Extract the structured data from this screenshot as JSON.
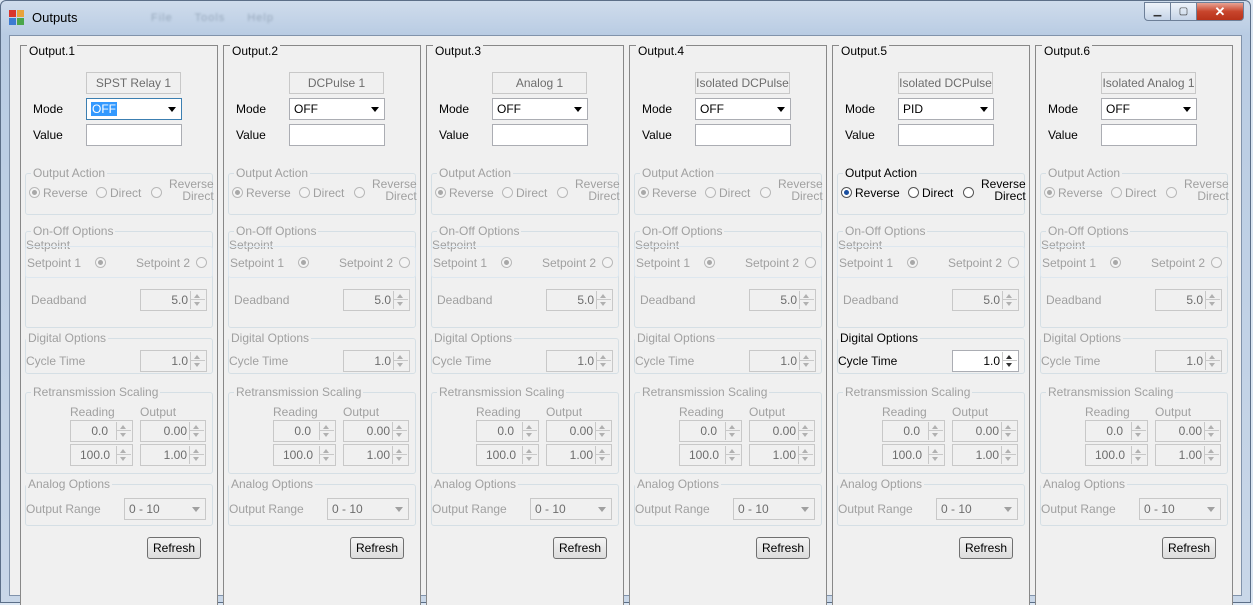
{
  "window": {
    "title": "Outputs",
    "ghost_menu": [
      "File",
      "Tools",
      "Help"
    ]
  },
  "labels": {
    "mode": "Mode",
    "value": "Value",
    "output_action": "Output Action",
    "reverse": "Reverse",
    "direct": "Direct",
    "reverse_direct_1": "Reverse",
    "reverse_direct_2": "Direct",
    "onoff_options": "On-Off Options",
    "setpoint": "Setpoint",
    "setpoint1": "Setpoint 1",
    "setpoint2": "Setpoint 2",
    "deadband": "Deadband",
    "digital_options": "Digital Options",
    "cycle_time": "Cycle Time",
    "retrans_scaling": "Retransmission Scaling",
    "reading": "Reading",
    "output": "Output",
    "analog_options": "Analog Options",
    "output_range": "Output Range",
    "refresh": "Refresh"
  },
  "outputs": [
    {
      "title": "Output.1",
      "device": "SPST Relay 1",
      "mode": "OFF",
      "value": "",
      "deadband": "5.0",
      "cycle_time": "1.0",
      "reading_low": "0.0",
      "output_low": "0.00",
      "reading_high": "100.0",
      "output_high": "1.00",
      "output_range": "0 - 10"
    },
    {
      "title": "Output.2",
      "device": "DCPulse 1",
      "mode": "OFF",
      "value": "",
      "deadband": "5.0",
      "cycle_time": "1.0",
      "reading_low": "0.0",
      "output_low": "0.00",
      "reading_high": "100.0",
      "output_high": "1.00",
      "output_range": "0 - 10"
    },
    {
      "title": "Output.3",
      "device": "Analog 1",
      "mode": "OFF",
      "value": "",
      "deadband": "5.0",
      "cycle_time": "1.0",
      "reading_low": "0.0",
      "output_low": "0.00",
      "reading_high": "100.0",
      "output_high": "1.00",
      "output_range": "0 - 10"
    },
    {
      "title": "Output.4",
      "device": "Isolated DCPulse",
      "mode": "OFF",
      "value": "",
      "deadband": "5.0",
      "cycle_time": "1.0",
      "reading_low": "0.0",
      "output_low": "0.00",
      "reading_high": "100.0",
      "output_high": "1.00",
      "output_range": "0 - 10"
    },
    {
      "title": "Output.5",
      "device": "Isolated DCPulse",
      "mode": "PID",
      "value": "",
      "deadband": "5.0",
      "cycle_time": "1.0",
      "reading_low": "0.0",
      "output_low": "0.00",
      "reading_high": "100.0",
      "output_high": "1.00",
      "output_range": "0 - 10"
    },
    {
      "title": "Output.6",
      "device": "Isolated Analog 1",
      "mode": "OFF",
      "value": "",
      "deadband": "5.0",
      "cycle_time": "1.0",
      "reading_low": "0.0",
      "output_low": "0.00",
      "reading_high": "100.0",
      "output_high": "1.00",
      "output_range": "0 - 10"
    }
  ]
}
